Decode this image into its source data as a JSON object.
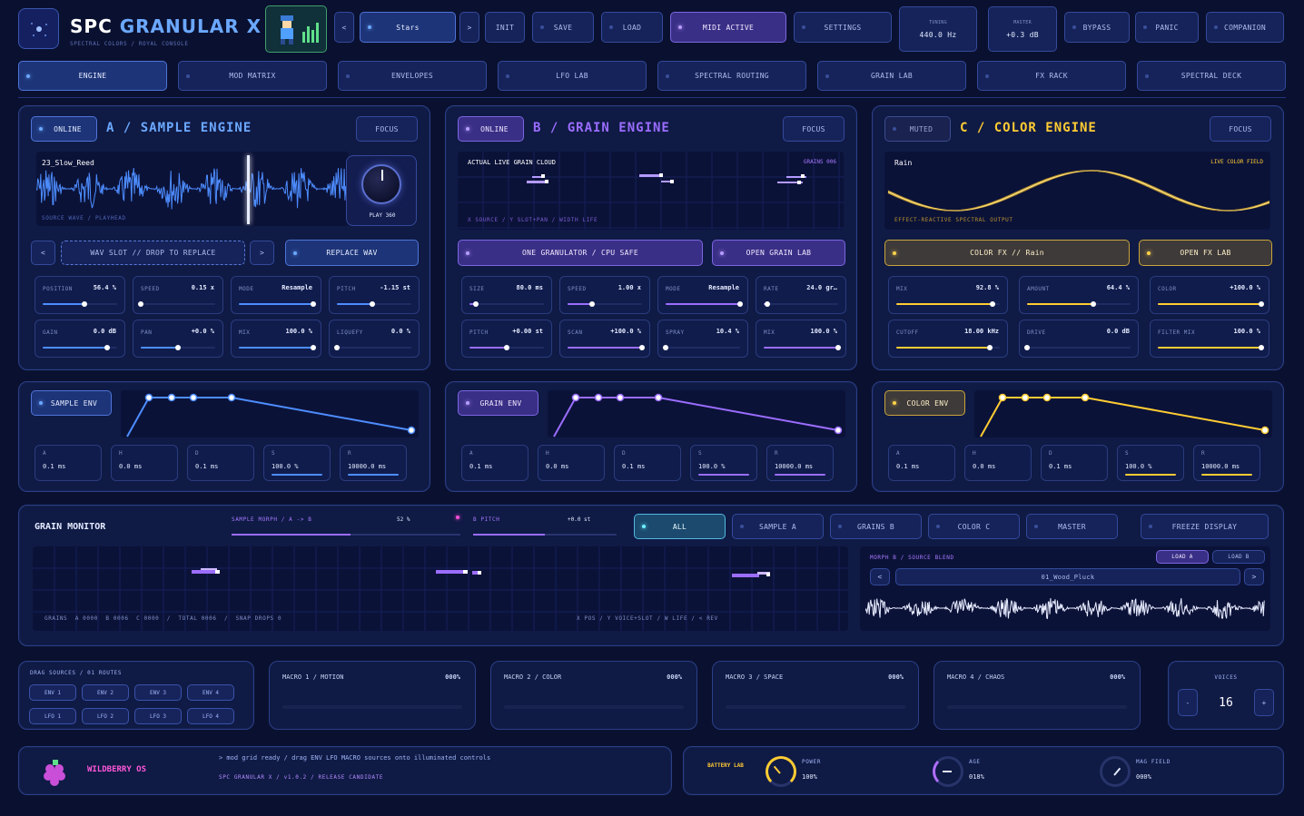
{
  "app": {
    "title_prefix": "SPC",
    "title_main": "GRANULAR X",
    "subtitle": "SPECTRAL COLORS / ROYAL CONSOLE"
  },
  "header": {
    "preset_prev": "<",
    "preset_name": "Stars",
    "preset_next": ">",
    "init": "INIT",
    "save": "SAVE",
    "load": "LOAD",
    "midi": "MIDI ACTIVE",
    "settings": "SETTINGS",
    "tuning_label": "TUNING",
    "tuning_value": "440.0 Hz",
    "master_label": "MASTER",
    "master_value": "+0.3 dB",
    "bypass": "BYPASS",
    "panic": "PANIC",
    "companion": "COMPANION"
  },
  "tabs": [
    "ENGINE",
    "MOD MATRIX",
    "ENVELOPES",
    "LFO LAB",
    "SPECTRAL ROUTING",
    "GRAIN LAB",
    "FX RACK",
    "SPECTRAL DECK"
  ],
  "engine_a": {
    "status": "ONLINE",
    "title": "A / SAMPLE ENGINE",
    "focus": "FOCUS",
    "sample_name": "23_Slow_Reed",
    "wave_caption": "SOURCE WAVE / PLAYHEAD",
    "play_label": "PLAY 360",
    "slot_prev": "<",
    "slot_label": "WAV SLOT // DROP TO REPLACE",
    "slot_next": ">",
    "replace": "REPLACE WAV",
    "params": [
      {
        "label": "POSITION",
        "value": "56.4 %",
        "level": 0.56
      },
      {
        "label": "SPEED",
        "value": "0.15 x",
        "level": 0.0
      },
      {
        "label": "MODE",
        "value": "Resample",
        "level": 1.0
      },
      {
        "label": "PITCH",
        "value": "-1.15 st",
        "level": 0.48
      },
      {
        "label": "GAIN",
        "value": "0.0 dB",
        "level": 0.87
      },
      {
        "label": "PAN",
        "value": "+0.0 %",
        "level": 0.5
      },
      {
        "label": "MIX",
        "value": "100.0 %",
        "level": 1.0
      },
      {
        "label": "LIQUEFY",
        "value": "0.0 %",
        "level": 0.0
      }
    ]
  },
  "engine_b": {
    "status": "ONLINE",
    "title": "B / GRAIN ENGINE",
    "focus": "FOCUS",
    "cloud_label": "ACTUAL LIVE GRAIN CLOUD",
    "grains_label": "GRAINS 006",
    "cloud_caption": "X SOURCE / Y SLOT+PAN / WIDTH LIFE",
    "mode_button": "ONE GRANULATOR / CPU SAFE",
    "open_lab": "OPEN GRAIN LAB",
    "params": [
      {
        "label": "SIZE",
        "value": "80.0 ms",
        "level": 0.08
      },
      {
        "label": "SPEED",
        "value": "1.00 x",
        "level": 0.33
      },
      {
        "label": "MODE",
        "value": "Resample",
        "level": 1.0
      },
      {
        "label": "RATE",
        "value": "24.0 gr…",
        "level": 0.05
      },
      {
        "label": "PITCH",
        "value": "+0.00 st",
        "level": 0.5
      },
      {
        "label": "SCAN",
        "value": "+100.0 %",
        "level": 1.0
      },
      {
        "label": "SPRAY",
        "value": "10.4 %",
        "level": 0.0
      },
      {
        "label": "MIX",
        "value": "100.0 %",
        "level": 1.0
      }
    ]
  },
  "engine_c": {
    "status": "MUTED",
    "title": "C / COLOR ENGINE",
    "focus": "FOCUS",
    "field_name": "Rain",
    "field_label": "LIVE COLOR FIELD",
    "field_caption": "EFFECT-REACTIVE SPECTRAL OUTPUT",
    "fx_button": "COLOR FX // Rain",
    "open_fx": "OPEN FX LAB",
    "params": [
      {
        "label": "MIX",
        "value": "92.8 %",
        "level": 0.93
      },
      {
        "label": "AMOUNT",
        "value": "64.4 %",
        "level": 0.64
      },
      {
        "label": "COLOR",
        "value": "+100.0 %",
        "level": 1.0
      },
      {
        "label": "CUTOFF",
        "value": "18.00 kHz",
        "level": 0.9
      },
      {
        "label": "DRIVE",
        "value": "0.0 dB",
        "level": 0.0
      },
      {
        "label": "FILTER MIX",
        "value": "100.0 %",
        "level": 1.0
      }
    ]
  },
  "env_a": {
    "name": "SAMPLE ENV",
    "stages": [
      {
        "label": "A",
        "value": "0.1 ms"
      },
      {
        "label": "H",
        "value": "0.0 ms"
      },
      {
        "label": "D",
        "value": "0.1 ms"
      },
      {
        "label": "S",
        "value": "100.0 %"
      },
      {
        "label": "R",
        "value": "10000.0 ms"
      }
    ]
  },
  "env_b": {
    "name": "GRAIN ENV",
    "stages": [
      {
        "label": "A",
        "value": "0.1 ms"
      },
      {
        "label": "H",
        "value": "0.0 ms"
      },
      {
        "label": "D",
        "value": "0.1 ms"
      },
      {
        "label": "S",
        "value": "100.0 %"
      },
      {
        "label": "R",
        "value": "10000.0 ms"
      }
    ]
  },
  "env_c": {
    "name": "COLOR ENV",
    "stages": [
      {
        "label": "A",
        "value": "0.1 ms"
      },
      {
        "label": "H",
        "value": "0.0 ms"
      },
      {
        "label": "D",
        "value": "0.1 ms"
      },
      {
        "label": "S",
        "value": "100.0 %"
      },
      {
        "label": "R",
        "value": "10000.0 ms"
      }
    ]
  },
  "monitor": {
    "title": "GRAIN MONITOR",
    "morph_label": "SAMPLE MORPH / A -> B",
    "morph_value": "52 %",
    "morph_level": 0.52,
    "pitch_label": "B PITCH",
    "pitch_value": "+0.0 st",
    "pitch_level": 0.5,
    "filters": [
      "ALL",
      "SAMPLE A",
      "GRAINS B",
      "COLOR C",
      "MASTER"
    ],
    "freeze": "FREEZE DISPLAY",
    "stats": "GRAINS  A 0000  B 0006  C 0000  /  TOTAL 0006  /  SNAP DROPS 0",
    "legend": "X POS / Y VOICE+SLOT / W LIFE / < REV",
    "blend_label": "MORPH B / SOURCE BLEND",
    "load_a": "LOAD A",
    "load_b": "LOAD B",
    "blend_prev": "<",
    "blend_name": "01_Wood_Pluck",
    "blend_next": ">"
  },
  "routing": {
    "title": "DRAG SOURCES / 01 ROUTES",
    "sources": [
      "ENV 1",
      "ENV 2",
      "ENV 3",
      "ENV 4",
      "LFO 1",
      "LFO 2",
      "LFO 3",
      "LFO 4"
    ]
  },
  "macros": [
    {
      "name": "MACRO 1 / MOTION",
      "value": "000%"
    },
    {
      "name": "MACRO 2 / COLOR",
      "value": "000%"
    },
    {
      "name": "MACRO 3 / SPACE",
      "value": "000%"
    },
    {
      "name": "MACRO 4 / CHAOS",
      "value": "000%"
    }
  ],
  "voices": {
    "label": "VOICES",
    "value": "16",
    "minus": "-",
    "plus": "+"
  },
  "footer": {
    "brand": "WILDBERRY OS",
    "console_line": "> mod grid ready / drag ENV LFO MACRO sources onto illuminated controls",
    "version": "SPC GRANULAR X / v1.0.2 / RELEASE CANDIDATE",
    "battery_label": "BATTERY LAB",
    "power_label": "POWER",
    "power_value": "100%",
    "age_label": "AGE",
    "age_value": "018%",
    "mag_label": "MAG FIELD",
    "mag_value": "000%"
  },
  "colors": {
    "blue": "#4d8dff",
    "purple": "#9b6dff",
    "gold": "#ffcc33",
    "cyan": "#5fe6ff"
  }
}
